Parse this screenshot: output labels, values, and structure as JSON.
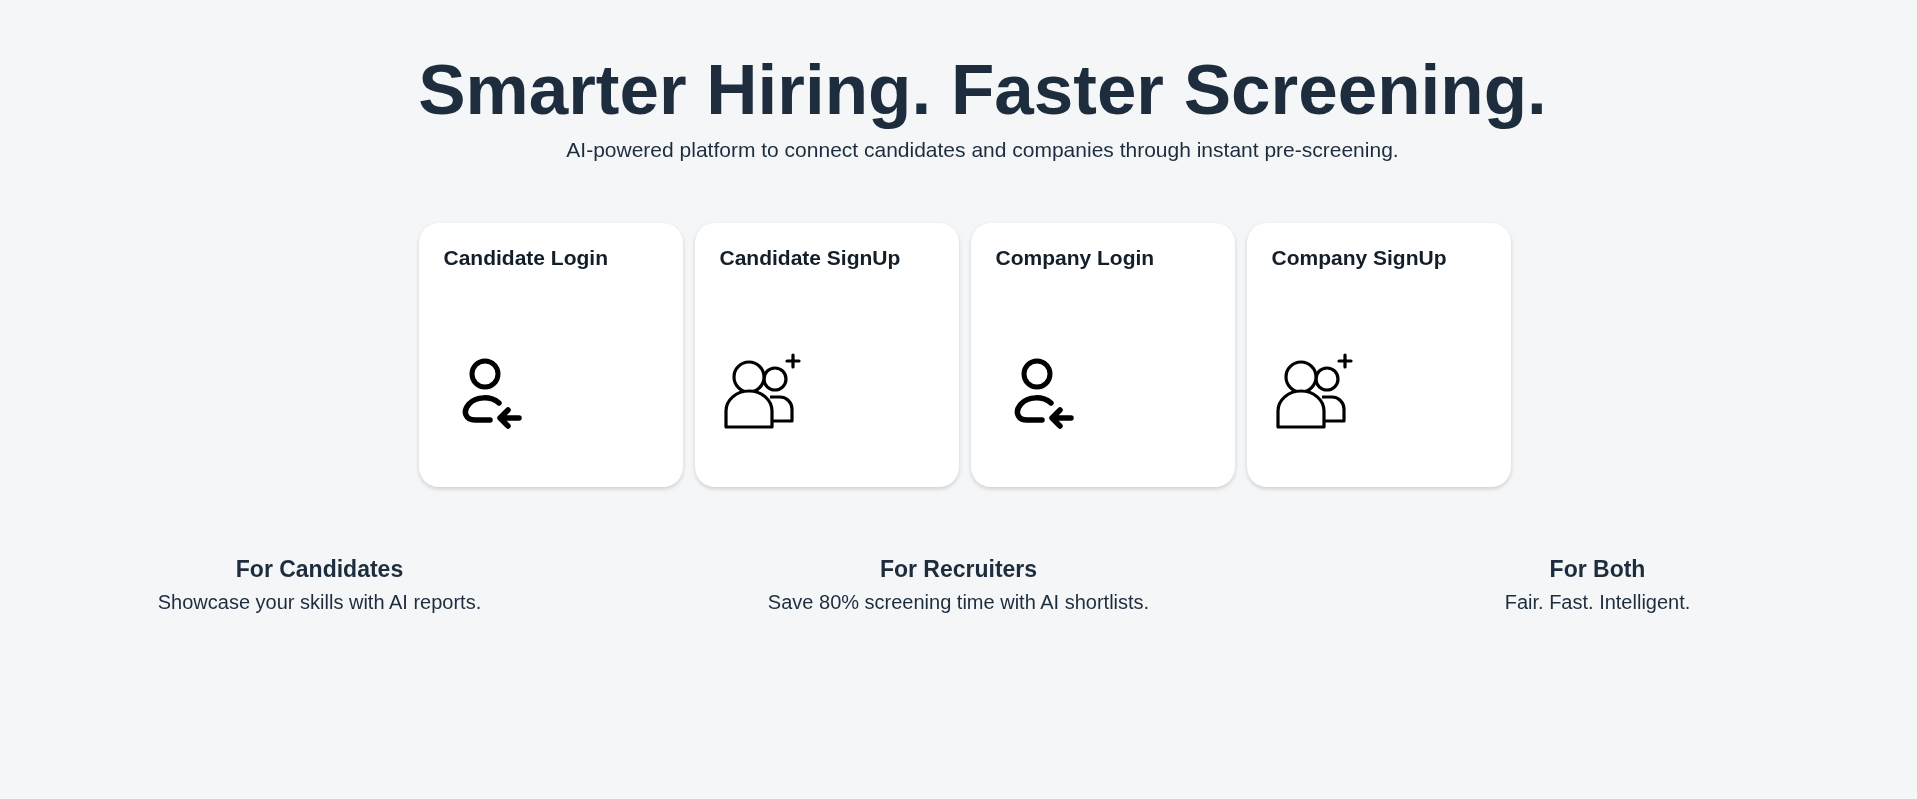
{
  "hero": {
    "title": "Smarter Hiring. Faster Screening.",
    "subtitle": "AI-powered platform to connect candidates and companies through instant pre-screening."
  },
  "cards": [
    {
      "title": "Candidate Login",
      "kind": "login"
    },
    {
      "title": "Candidate SignUp",
      "kind": "signup"
    },
    {
      "title": "Company Login",
      "kind": "login"
    },
    {
      "title": "Company SignUp",
      "kind": "signup"
    }
  ],
  "features": [
    {
      "title": "For Candidates",
      "text": "Showcase your skills with AI reports."
    },
    {
      "title": "For Recruiters",
      "text": "Save 80% screening time with AI shortlists."
    },
    {
      "title": "For Both",
      "text": "Fair. Fast. Intelligent."
    }
  ]
}
